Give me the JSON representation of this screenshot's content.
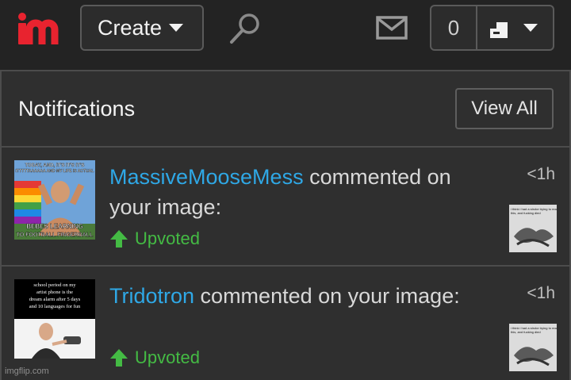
{
  "header": {
    "logo_text": "im",
    "create_label": "Create",
    "notification_count": "0",
    "icons": [
      "search-icon",
      "mail-icon",
      "user-icon"
    ]
  },
  "panel": {
    "title": "Notifications",
    "view_all_label": "View All",
    "notifications": [
      {
        "username": "MassiveMooseMess",
        "action": " commented on your image:",
        "vote_label": "Upvoted",
        "time": "<1h",
        "thumb_caption_top": "TODAY, AND, IT'S IT'S IT'S ITTTTTAAAAAA AND MY LIFE IS ACTUAL",
        "thumb_caption_bottom": "BEBES LEARNING TO FOOTBALL FINGERBALL",
        "small_thumb_caption": "i think i had a stroke trying to read this, and fucking died"
      },
      {
        "username": "Tridotron",
        "action": " commented on your image:",
        "vote_label": "Upvoted",
        "time": "<1h",
        "thumb_caption_top": "school period on my artist phone is the dream alarm after 5 days and 10 languages for fun",
        "small_thumb_caption": "i think i had a stroke trying to read this, and fucking died"
      }
    ]
  },
  "watermark": "imgflip.com",
  "colors": {
    "brand_red": "#e8232f",
    "username_blue": "#2fa8e6",
    "upvote_green": "#44bb44"
  }
}
